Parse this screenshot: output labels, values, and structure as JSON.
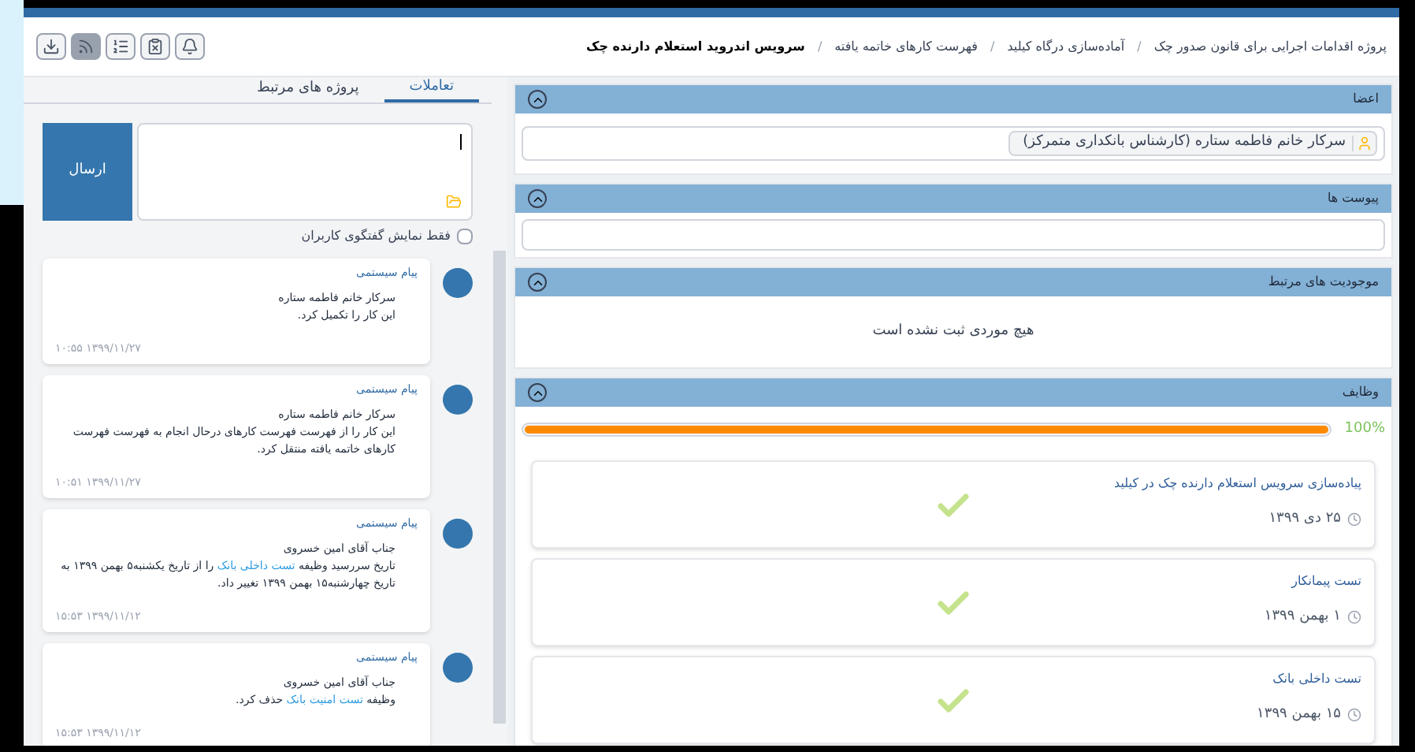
{
  "toolbar": [
    {
      "kind": "download",
      "selected": false
    },
    {
      "kind": "rss",
      "selected": true
    },
    {
      "kind": "list",
      "selected": false
    },
    {
      "kind": "checkx",
      "selected": false
    },
    {
      "kind": "bell",
      "selected": false
    }
  ],
  "breadcrumb": [
    {
      "label": "پروژه اقدامات اجرایی برای قانون صدور چک",
      "current": false
    },
    {
      "separator": "/",
      "label": "آماده‌سازی درگاه کیلید",
      "current": false
    },
    {
      "separator": "/",
      "label": "فهرست کارهای خاتمه یافته",
      "current": false
    },
    {
      "separator": "/",
      "label": "سرویس اندروید استعلام دارنده چک",
      "current": true
    }
  ],
  "sections": [
    {
      "kind": "members",
      "title": "اعضا",
      "expanded": true,
      "members": [
        "سرکار خانم فاطمه ستاره (کارشناس بانکداری متمرکز)"
      ]
    },
    {
      "kind": "attachments",
      "title": "پیوست ها",
      "expanded": true
    },
    {
      "kind": "empty",
      "title": "موجودیت های مرتبط",
      "expanded": true,
      "message": "هیچ موردی ثبت نشده است"
    },
    {
      "kind": "tasks",
      "title": "وظایف",
      "expanded": true,
      "progress": {
        "level": 1,
        "label": "100%"
      },
      "tasks": [
        {
          "title": "پیاده‌سازی سرویس استعلام دارنده چک در کیلید",
          "date": "۲۵ دی ۱۳۹۹",
          "done": true
        },
        {
          "title": "تست پیمانکار",
          "date": "۱ بهمن ۱۳۹۹",
          "done": true
        },
        {
          "title": "تست داخلی بانک",
          "date": "۱۵ بهمن ۱۳۹۹",
          "done": true
        }
      ]
    }
  ],
  "tabs": [
    {
      "label": "تعاملات",
      "selected": true
    },
    {
      "label": "پروژه های مرتبط",
      "selected": false
    }
  ],
  "composer": {
    "send": "ارسال",
    "filter": {
      "label": "فقط نمایش گفتگوی کاربران",
      "checked": false
    }
  },
  "messages": [
    {
      "title": "پیام سیستمی",
      "lines": [
        [
          {
            "kind": "text",
            "text": "سرکار خانم فاطمه ستاره"
          }
        ],
        [
          {
            "kind": "text",
            "text": "این کار را تکمیل کرد."
          }
        ]
      ],
      "time": "۱۰:۵۵ ۱۳۹۹/۱۱/۲۷"
    },
    {
      "title": "پیام سیستمی",
      "lines": [
        [
          {
            "kind": "text",
            "text": "سرکار خانم فاطمه ستاره"
          }
        ],
        [
          {
            "kind": "text",
            "text": "این کار را از فهرست فهرست کارهای درحال انجام  به فهرست فهرست کارهای خاتمه یافته  منتقل کرد."
          }
        ]
      ],
      "time": "۱۰:۵۱ ۱۳۹۹/۱۱/۲۷"
    },
    {
      "title": "پیام سیستمی",
      "lines": [
        [
          {
            "kind": "text",
            "text": "جناب آقای امین خسروی"
          }
        ],
        [
          {
            "kind": "text",
            "text": "تاریخ سررسید وظیفه "
          },
          {
            "kind": "link",
            "text": "تست داخلی بانک"
          },
          {
            "kind": "text",
            "text": " را  از تاریخ یکشنبه۵ بهمن ۱۳۹۹ به تاریخ چهارشنبه۱۵ بهمن ۱۳۹۹ تغییر داد."
          }
        ]
      ],
      "time": "۱۵:۵۳ ۱۳۹۹/۱۱/۱۲"
    },
    {
      "title": "پیام سیستمی",
      "lines": [
        [
          {
            "kind": "text",
            "text": "جناب آقای امین خسروی"
          }
        ],
        [
          {
            "kind": "text",
            "text": "وظیفه "
          },
          {
            "kind": "link",
            "text": "تست امنیت بانک"
          },
          {
            "kind": "text",
            "text": " حذف کرد."
          }
        ]
      ],
      "time": "۱۵:۵۳ ۱۳۹۹/۱۱/۱۲"
    }
  ]
}
